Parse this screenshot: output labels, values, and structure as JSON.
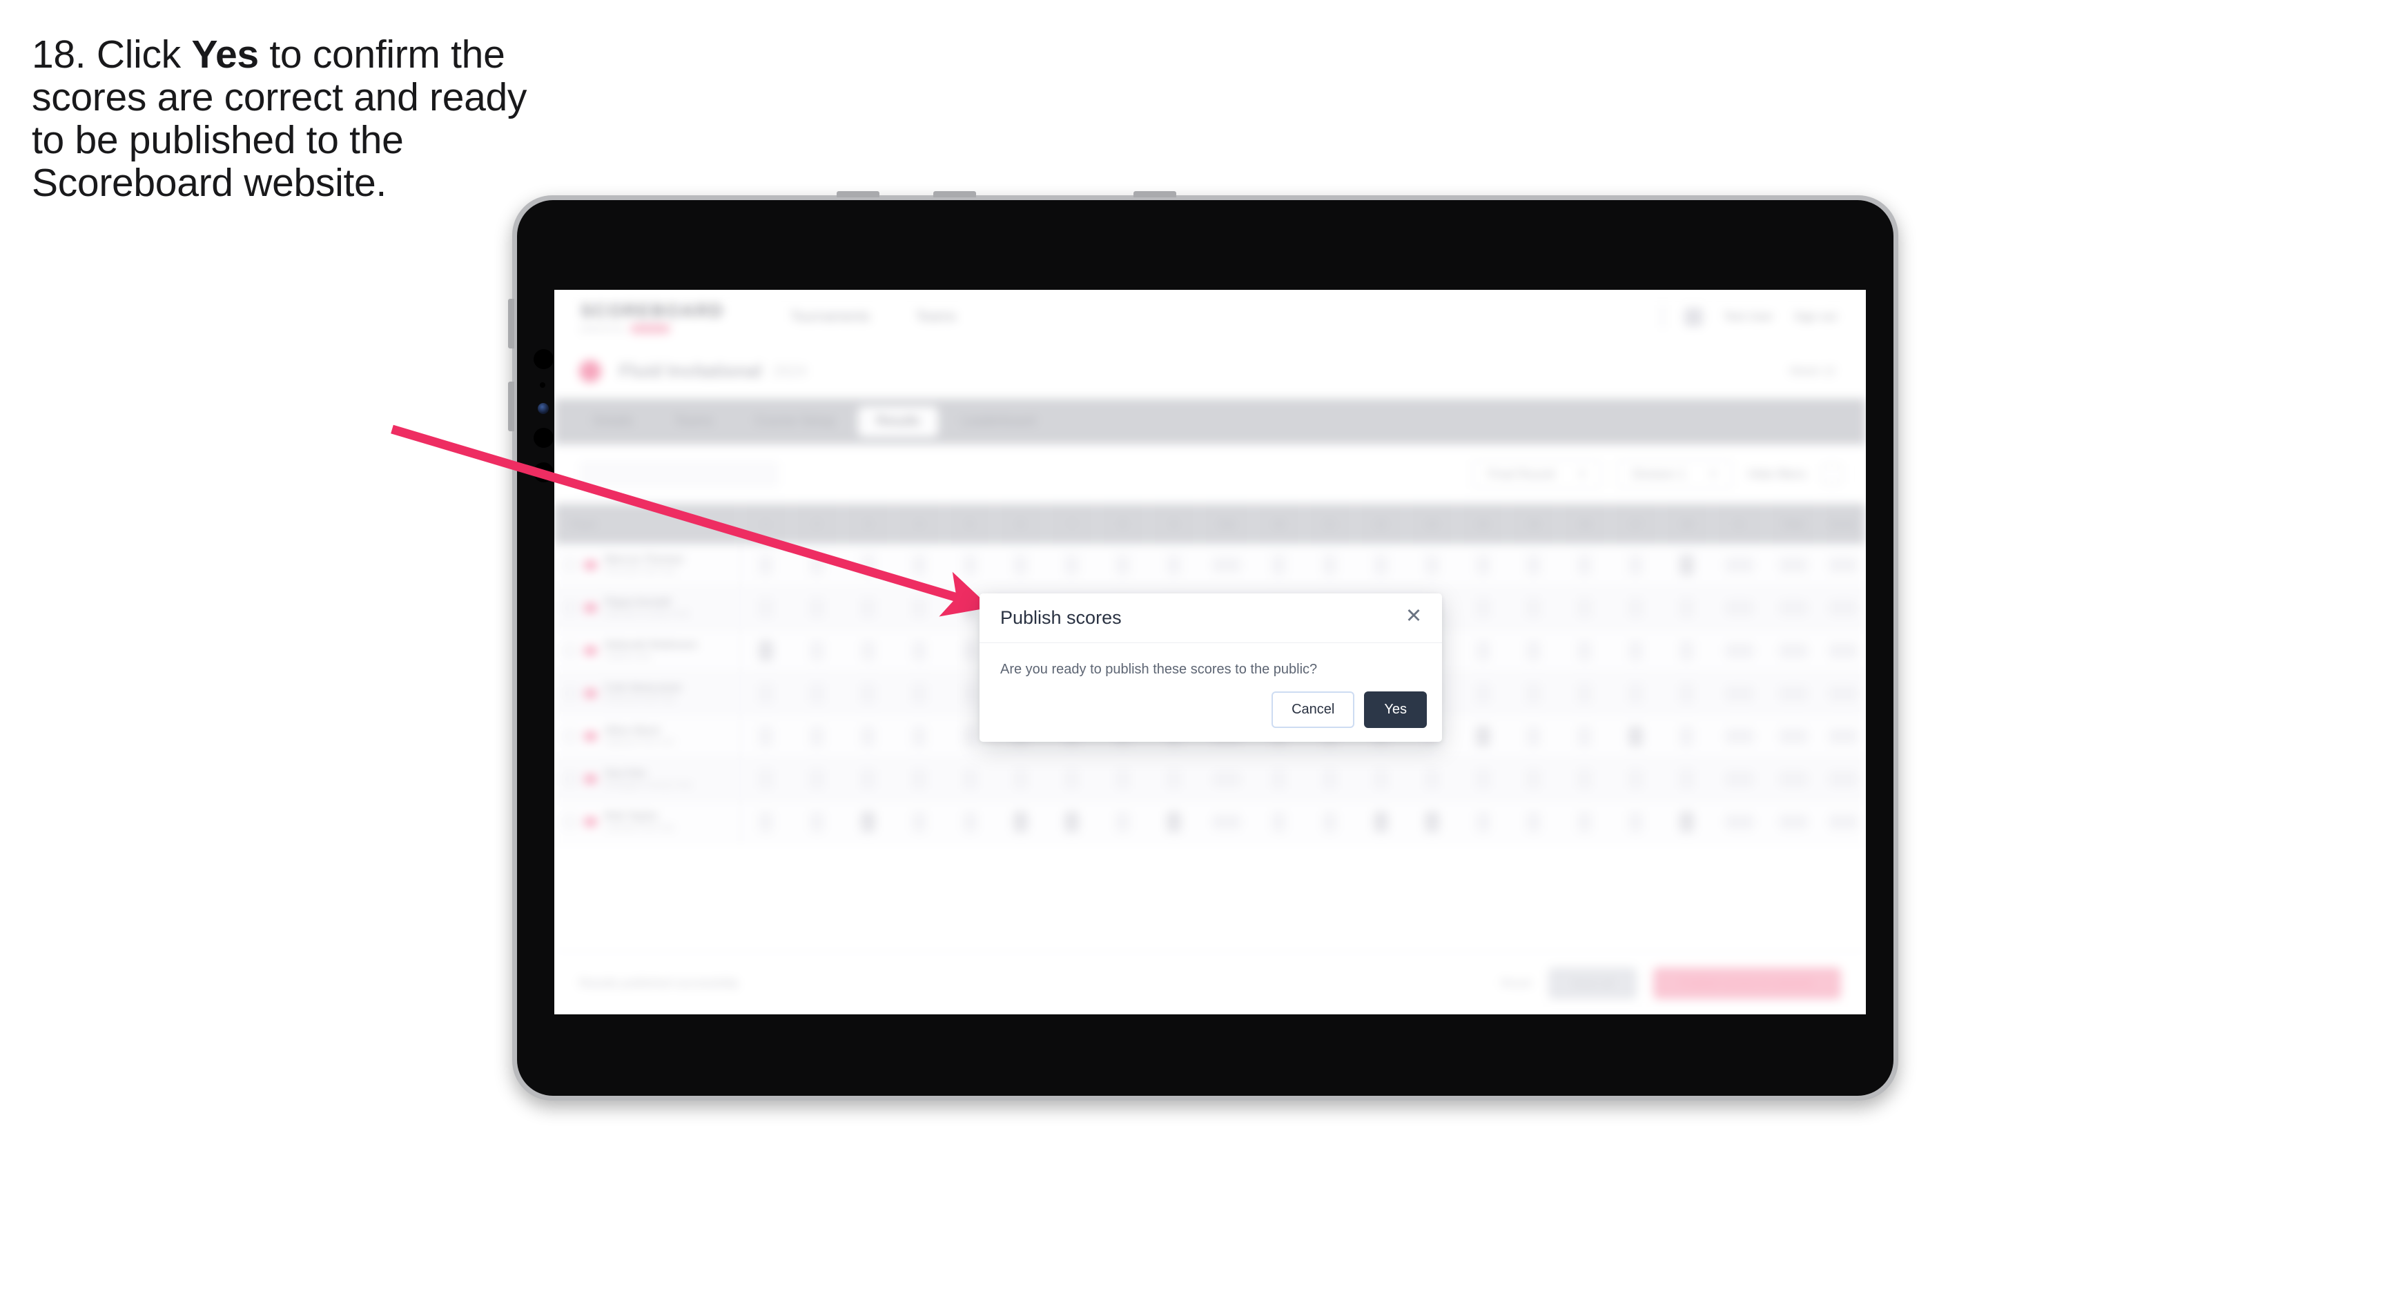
{
  "instruction": {
    "number": "18.",
    "text_before": "Click",
    "emphasis": "Yes",
    "text_after": "to confirm the scores are correct and ready to be published to the Scoreboard website."
  },
  "annotation": {
    "arrow_color": "#ee2d62",
    "arrow_name": "pointer-arrow"
  },
  "device": {
    "type": "tablet",
    "bezel_color": "#b9babd",
    "body_color": "#0b0b0c"
  },
  "app": {
    "brand": {
      "name": "SCOREBOARD",
      "tagline": "powered by"
    },
    "nav": [
      "Tournaments",
      "Teams"
    ],
    "header_right": {
      "user": "Test User",
      "signout": "Sign out"
    },
    "event": {
      "title": "Fluid Invitational",
      "year": "2024",
      "right_meta": "Week 12"
    },
    "tabs": [
      {
        "label": "Details",
        "active": false
      },
      {
        "label": "Teams",
        "active": false
      },
      {
        "label": "Course Setup",
        "active": false
      },
      {
        "label": "Results",
        "active": true
      },
      {
        "label": "Leaderboard",
        "active": false
      }
    ],
    "filters": {
      "search_placeholder": "Search",
      "round_select": "Final Round",
      "division_select": "Division 1",
      "link": "Hide filters"
    },
    "table": {
      "columns": [
        "Player",
        "1",
        "2",
        "3",
        "4",
        "5",
        "6",
        "7",
        "8",
        "9",
        "Out",
        "10",
        "11",
        "12",
        "13",
        "14",
        "15",
        "16",
        "17",
        "18",
        "In",
        "Total",
        "Score"
      ],
      "rows": [
        {
          "name": "Marcus Thomas",
          "club": "Riverside Golf Club"
        },
        {
          "name": "Pippa Donald",
          "club": "Glenview Country Club"
        },
        {
          "name": "Deborah Robinson",
          "club": "Oakhill Links"
        },
        {
          "name": "Cole Newcomer",
          "club": "Pinecrest Golf Club"
        },
        {
          "name": "Olive Short",
          "club": "Highland Park Golf"
        },
        {
          "name": "Sue Kim",
          "club": "Northgate Country Club"
        },
        {
          "name": "Rob Taylor",
          "club": "Lakeside Golf Club"
        }
      ]
    },
    "actionbar": {
      "note": "Results published successfully",
      "link": "Reset",
      "secondary_button": "Save all",
      "primary_button": "Publish scores to website"
    }
  },
  "modal": {
    "title": "Publish scores",
    "body": "Are you ready to publish these scores to the public?",
    "close_icon": "✕",
    "cancel_label": "Cancel",
    "confirm_label": "Yes",
    "confirm_color": "#2c3748"
  }
}
